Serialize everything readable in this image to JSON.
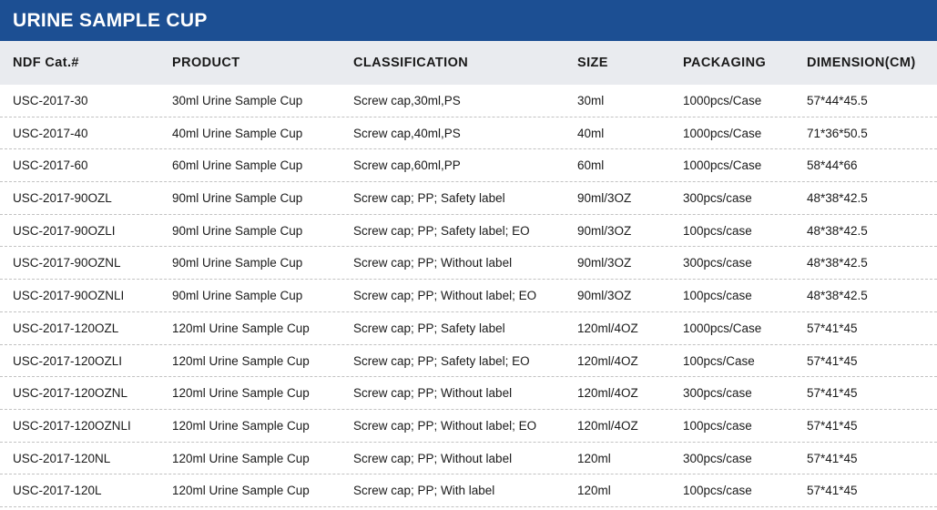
{
  "title": "URINE SAMPLE CUP",
  "columns": [
    "NDF Cat.#",
    "PRODUCT",
    "CLASSIFICATION",
    "SIZE",
    "PACKAGING",
    "DIMENSION(CM)"
  ],
  "rows": [
    [
      "USC-2017-30",
      "30ml Urine Sample Cup",
      "Screw cap,30ml,PS",
      "30ml",
      "1000pcs/Case",
      "57*44*45.5"
    ],
    [
      "USC-2017-40",
      "40ml Urine Sample Cup",
      "Screw cap,40ml,PS",
      "40ml",
      "1000pcs/Case",
      "71*36*50.5"
    ],
    [
      "USC-2017-60",
      "60ml Urine Sample Cup",
      "Screw cap,60ml,PP",
      "60ml",
      "1000pcs/Case",
      "58*44*66"
    ],
    [
      "USC-2017-90OZL",
      "90ml Urine Sample Cup",
      "Screw cap; PP; Safety label",
      "90ml/3OZ",
      "300pcs/case",
      "48*38*42.5"
    ],
    [
      "USC-2017-90OZLI",
      "90ml Urine Sample Cup",
      "Screw cap; PP; Safety label; EO",
      "90ml/3OZ",
      "100pcs/case",
      "48*38*42.5"
    ],
    [
      "USC-2017-90OZNL",
      "90ml Urine Sample Cup",
      "Screw cap; PP; Without label",
      "90ml/3OZ",
      "300pcs/case",
      "48*38*42.5"
    ],
    [
      "USC-2017-90OZNLI",
      "90ml Urine Sample Cup",
      "Screw cap; PP; Without label; EO",
      "90ml/3OZ",
      "100pcs/case",
      "48*38*42.5"
    ],
    [
      "USC-2017-120OZL",
      "120ml Urine Sample Cup",
      "Screw cap; PP; Safety label",
      "120ml/4OZ",
      "1000pcs/Case",
      "57*41*45"
    ],
    [
      "USC-2017-120OZLI",
      "120ml Urine Sample Cup",
      "Screw cap; PP; Safety label; EO",
      "120ml/4OZ",
      "100pcs/Case",
      "57*41*45"
    ],
    [
      "USC-2017-120OZNL",
      "120ml Urine Sample Cup",
      "Screw cap; PP; Without label",
      "120ml/4OZ",
      "300pcs/case",
      "57*41*45"
    ],
    [
      "USC-2017-120OZNLI",
      "120ml Urine Sample Cup",
      "Screw cap; PP; Without label; EO",
      "120ml/4OZ",
      "100pcs/case",
      "57*41*45"
    ],
    [
      "USC-2017-120NL",
      "120ml Urine Sample Cup",
      "Screw cap; PP; Without label",
      "120ml",
      "300pcs/case",
      "57*41*45"
    ],
    [
      "USC-2017-120L",
      "120ml Urine Sample Cup",
      "Screw cap; PP; With label",
      "120ml",
      "100pcs/case",
      "57*41*45"
    ]
  ],
  "colors": {
    "title_bg": "#1c4f93",
    "title_text": "#ffffff",
    "header_bg": "#e9ebef",
    "row_divider": "#c2c2c2"
  }
}
